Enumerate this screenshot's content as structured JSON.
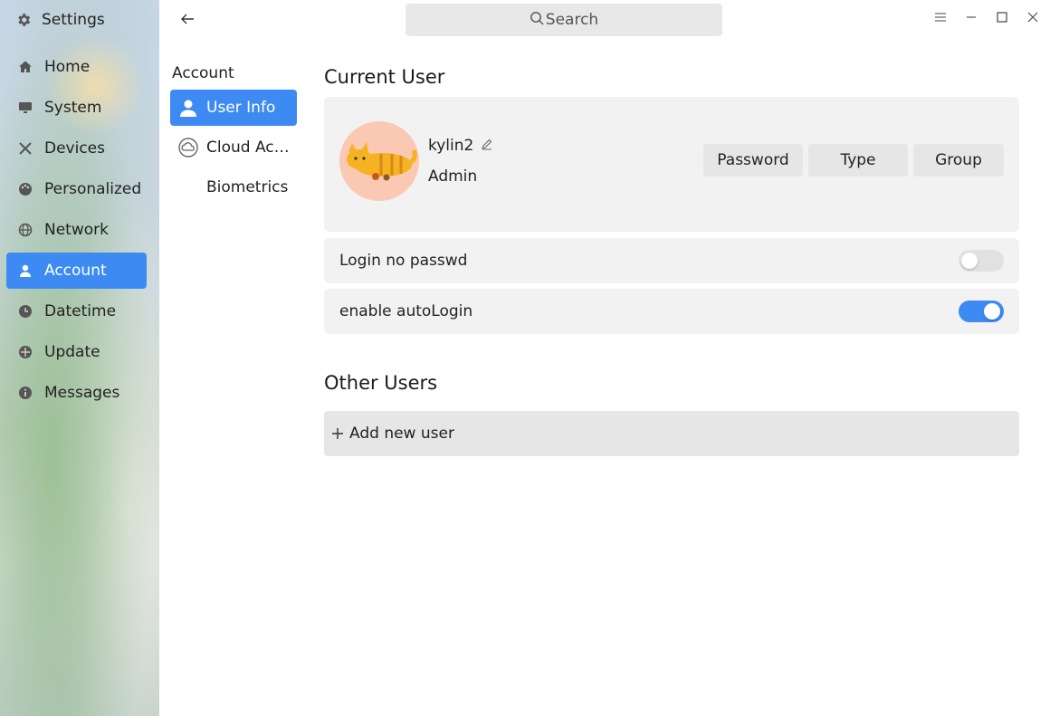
{
  "app": {
    "title": "Settings"
  },
  "sidebar": {
    "items": [
      {
        "label": "Home",
        "icon": "home-icon"
      },
      {
        "label": "System",
        "icon": "monitor-icon"
      },
      {
        "label": "Devices",
        "icon": "tools-icon"
      },
      {
        "label": "Personalized",
        "icon": "palette-icon"
      },
      {
        "label": "Network",
        "icon": "globe-icon"
      },
      {
        "label": "Account",
        "icon": "person-icon",
        "active": true
      },
      {
        "label": "Datetime",
        "icon": "clock-icon"
      },
      {
        "label": "Update",
        "icon": "update-icon"
      },
      {
        "label": "Messages",
        "icon": "info-icon"
      }
    ]
  },
  "search": {
    "placeholder": "Search"
  },
  "subnav": {
    "title": "Account",
    "items": [
      {
        "label": "User Info",
        "icon": "person-icon",
        "active": true
      },
      {
        "label": "Cloud Account",
        "icon": "cloud-icon"
      },
      {
        "label": "Biometrics"
      }
    ]
  },
  "current_user": {
    "heading": "Current User",
    "name": "kylin2",
    "role": "Admin",
    "buttons": {
      "password": "Password",
      "type": "Type",
      "group": "Group"
    }
  },
  "settings": {
    "login_no_passwd": {
      "label": "Login no passwd",
      "enabled": false
    },
    "auto_login": {
      "label": "enable autoLogin",
      "enabled": true
    }
  },
  "other_users": {
    "heading": "Other Users",
    "add_label": "Add new user"
  },
  "colors": {
    "accent": "#3d8bf2",
    "card": "#f2f2f2",
    "avatar_bg": "#fbc9b3"
  }
}
